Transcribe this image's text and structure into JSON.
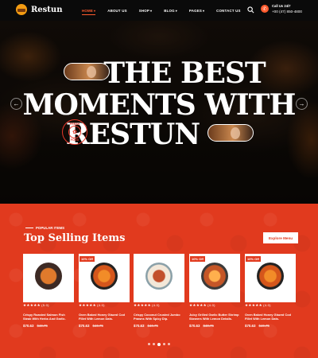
{
  "header": {
    "logo_text": "Restun",
    "nav": [
      {
        "label": "HOME",
        "active": true,
        "has_caret": true
      },
      {
        "label": "ABOUT US",
        "active": false,
        "has_caret": false
      },
      {
        "label": "SHOP",
        "active": false,
        "has_caret": true
      },
      {
        "label": "BLOG",
        "active": false,
        "has_caret": true
      },
      {
        "label": "PAGES",
        "active": false,
        "has_caret": true
      },
      {
        "label": "CONTACT US",
        "active": false,
        "has_caret": false
      }
    ],
    "call_label": "Call Us 24/7",
    "call_number": "+00 (47) 850-4800",
    "icons": [
      "search-icon",
      "phone-icon"
    ]
  },
  "hero": {
    "line1": "THE BEST",
    "line2": "MOMENTS WITH",
    "line3": "RESTUN",
    "stamp_top": "FRESH",
    "stamp_bottom": "FOOD",
    "prev_arrow": "←",
    "next_arrow": "→"
  },
  "popular": {
    "eyebrow": "POPULAR ITEMS",
    "title": "Top Selling Items",
    "explore_label": "Explore Menu",
    "items": [
      {
        "badge": "",
        "rating": "(5.0)",
        "name": "Crispy Roasted Salmon Fish Steak With Herbs And Garlic.",
        "price": "$70.63",
        "old_price": "$40.75"
      },
      {
        "badge": "10% Off",
        "rating": "(4.0)",
        "name": "Oven Baked Honey Glazed Cod Fillet With Lemon Dats.",
        "price": "$70.63",
        "old_price": "$40.75"
      },
      {
        "badge": "",
        "rating": "(4.0)",
        "name": "Crispy Coconut Crusted Jumbo Prawns With Spicy Dip.",
        "price": "$70.63",
        "old_price": "$40.75"
      },
      {
        "badge": "10% Off",
        "rating": "(4.0)",
        "name": "Juicy Grilled Garlic Butter Shrimp Skewers With Lemon Details.",
        "price": "$70.63",
        "old_price": "$40.75"
      },
      {
        "badge": "10% Off",
        "rating": "(4.0)",
        "name": "Oven Baked Honey Glazed Cod Fillet With Lemon Dats.",
        "price": "$70.63",
        "old_price": "$40.75"
      }
    ],
    "stars": "★★★★★",
    "slider_dots": 5,
    "active_dot": 2
  },
  "colors": {
    "accent": "#e13a1e",
    "nav_active": "#ff5b2e"
  }
}
